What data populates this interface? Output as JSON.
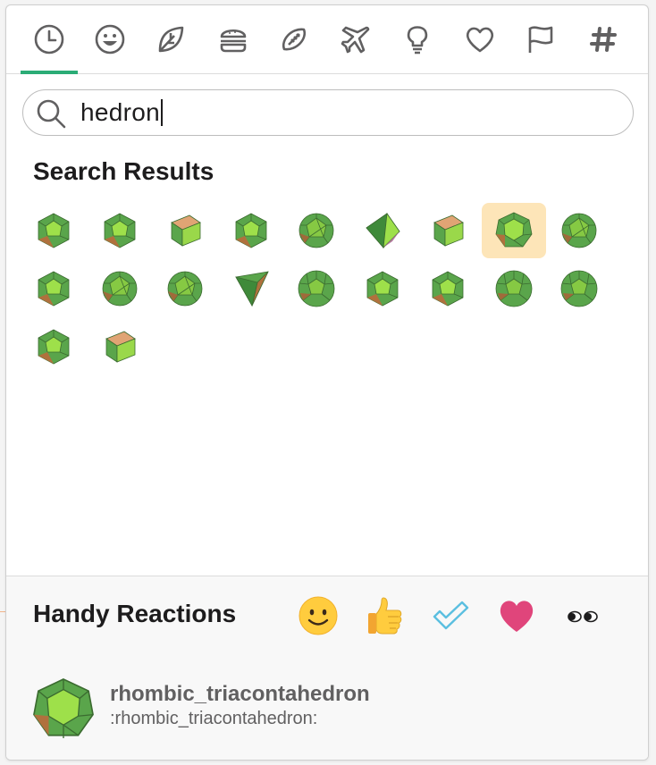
{
  "tabs": [
    {
      "icon": "clock-icon",
      "active": true
    },
    {
      "icon": "smiley-icon"
    },
    {
      "icon": "leaf-icon"
    },
    {
      "icon": "burger-icon"
    },
    {
      "icon": "football-icon"
    },
    {
      "icon": "airplane-icon"
    },
    {
      "icon": "lightbulb-icon"
    },
    {
      "icon": "heart-icon"
    },
    {
      "icon": "flag-icon"
    },
    {
      "icon": "hash-icon"
    }
  ],
  "search": {
    "icon": "search-icon",
    "value": "hedron"
  },
  "results": {
    "title": "Search Results",
    "items": [
      {
        "shape": "dodecahedron-icon"
      },
      {
        "shape": "dodecahedron-icon"
      },
      {
        "shape": "cube-icon"
      },
      {
        "shape": "dodecahedron-icon"
      },
      {
        "shape": "icosahedron-icon"
      },
      {
        "shape": "octahedron-icon"
      },
      {
        "shape": "cube-icon"
      },
      {
        "shape": "rhombic-triacontahedron-icon",
        "selected": true
      },
      {
        "shape": "icosahedron-icon"
      },
      {
        "shape": "dodecahedron-icon"
      },
      {
        "shape": "icosahedron-icon"
      },
      {
        "shape": "icosahedron-icon"
      },
      {
        "shape": "tetrahedron-icon"
      },
      {
        "shape": "truncated-icosahedron-icon"
      },
      {
        "shape": "dodecahedron-icon"
      },
      {
        "shape": "dodecahedron-icon"
      },
      {
        "shape": "truncated-icosahedron-icon"
      },
      {
        "shape": "truncated-icosahedron-icon"
      },
      {
        "shape": "dodecahedron-icon"
      },
      {
        "shape": "cube-icon"
      }
    ]
  },
  "handy": {
    "title": "Handy Reactions",
    "reactions": [
      "slightly-smiling-face-icon",
      "thumbs-up-icon",
      "check-mark-icon",
      "heart-icon",
      "eyes-icon"
    ]
  },
  "preview": {
    "icon": "rhombic-triacontahedron-icon",
    "name": "rhombic_triacontahedron",
    "code": ":rhombic_triacontahedron:"
  },
  "colors": {
    "accent": "#2bac76",
    "highlight": "#fde5b8",
    "polyhedron_green": "#5aa54b",
    "polyhedron_light": "#9ee04a",
    "polyhedron_brown": "#b0713d",
    "heart_pink": "#e0457b",
    "check_blue": "#5bbfe0",
    "smiley_yellow": "#ffcc3e"
  }
}
